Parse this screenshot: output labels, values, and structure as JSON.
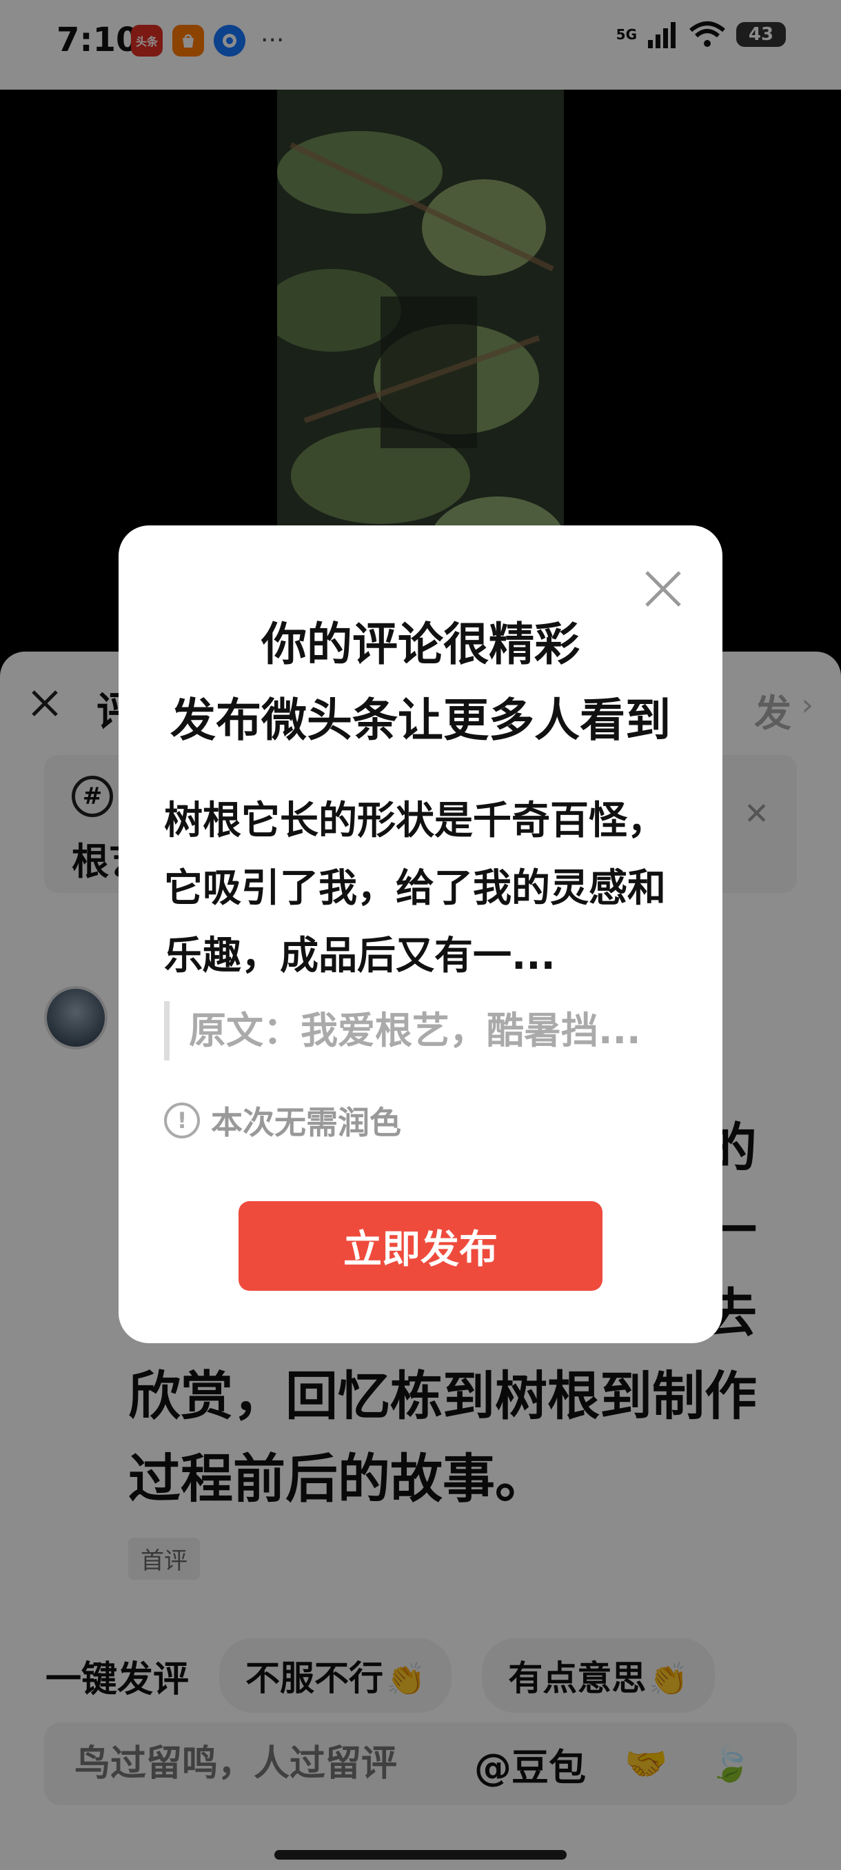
{
  "status_bar": {
    "time": "7:10",
    "apps": [
      {
        "name": "toutiao-app-icon",
        "label": "头条",
        "color": "#e02e24"
      },
      {
        "name": "shop-app-icon",
        "label": "",
        "color": "#ff7a00"
      },
      {
        "name": "browser-app-icon",
        "label": "",
        "color": "#1677ff"
      }
    ],
    "more": "···",
    "network": "5G",
    "battery": "43"
  },
  "sheet": {
    "title": "评",
    "publish": "发",
    "topic": "根艺",
    "comment": "树根它长的形状是千奇百怪，它吸引了我，给了我的灵感和乐趣，成品后又有一种成就感，闲暇之余独自去欣赏，回忆栋到树根到制作过程前后的故事。",
    "first_tag": "首评"
  },
  "quick_reply": {
    "label": "一键发评",
    "chips": [
      "不服不行",
      "有点意思"
    ]
  },
  "input": {
    "placeholder": "鸟过留鸣，人过留评",
    "mention": "@豆包"
  },
  "modal": {
    "title_line1": "你的评论很精彩",
    "title_line2": "发布微头条让更多人看到",
    "comment": "树根它长的形状是千奇百怪，它吸引了我，给了我的灵感和乐趣，成品后又有一...",
    "quote": "原文：我爱根艺，酷暑挡...",
    "note": "本次无需润色",
    "publish_button": "立即发布"
  }
}
